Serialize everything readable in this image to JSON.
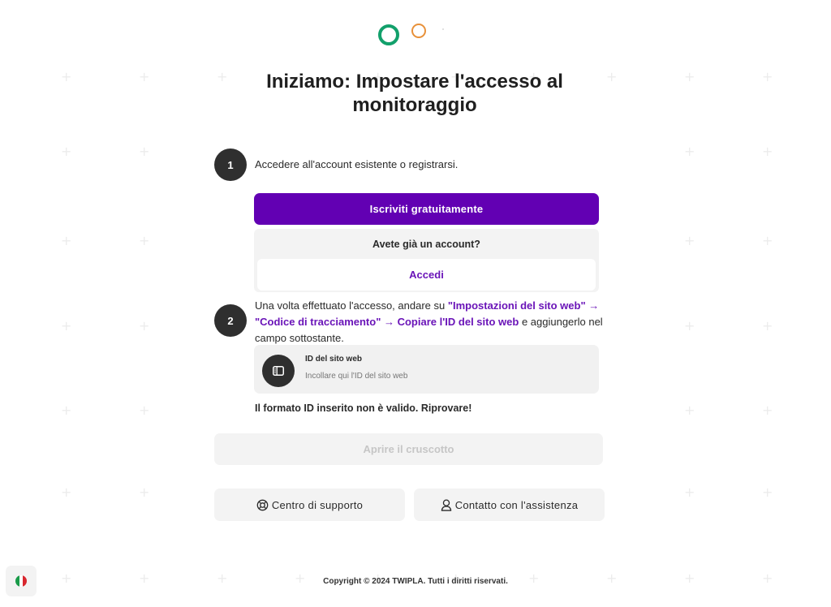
{
  "heading": "Iniziamo: Impostare l'accesso al monitoraggio",
  "steps": {
    "one": {
      "number": "1",
      "text": "Accedere all'account esistente o registrarsi."
    },
    "two": {
      "number": "2",
      "text_before": "Una volta effettuato l'accesso, andare su ",
      "highlight1": "\"Impostazioni del sito web\" → \"Codice di tracciamento\" → Copiare l'ID del sito web",
      "text_after": " e aggiungerlo nel campo sottostante."
    }
  },
  "signup_button": "Iscriviti gratuitamente",
  "account_question": "Avete già un account?",
  "login_button": "Accedi",
  "site_id_field": {
    "label": "ID del sito web",
    "value": "",
    "placeholder": "Incollare qui l'ID del sito web"
  },
  "error_message": "Il formato ID inserito non è valido. Riprovare!",
  "dashboard_button": "Aprire il cruscotto",
  "support_button": "Centro di supporto",
  "contact_button": "Contatto con l'assistenza",
  "copyright": "Copyright © 2024 TWIPLA. Tutti i diritti riservati.",
  "colors": {
    "accent": "#6200b3",
    "link": "#6a14b8",
    "logo_green": "#12a06b",
    "logo_orange": "#e8913a"
  },
  "language_flag": "italy-flag-icon"
}
